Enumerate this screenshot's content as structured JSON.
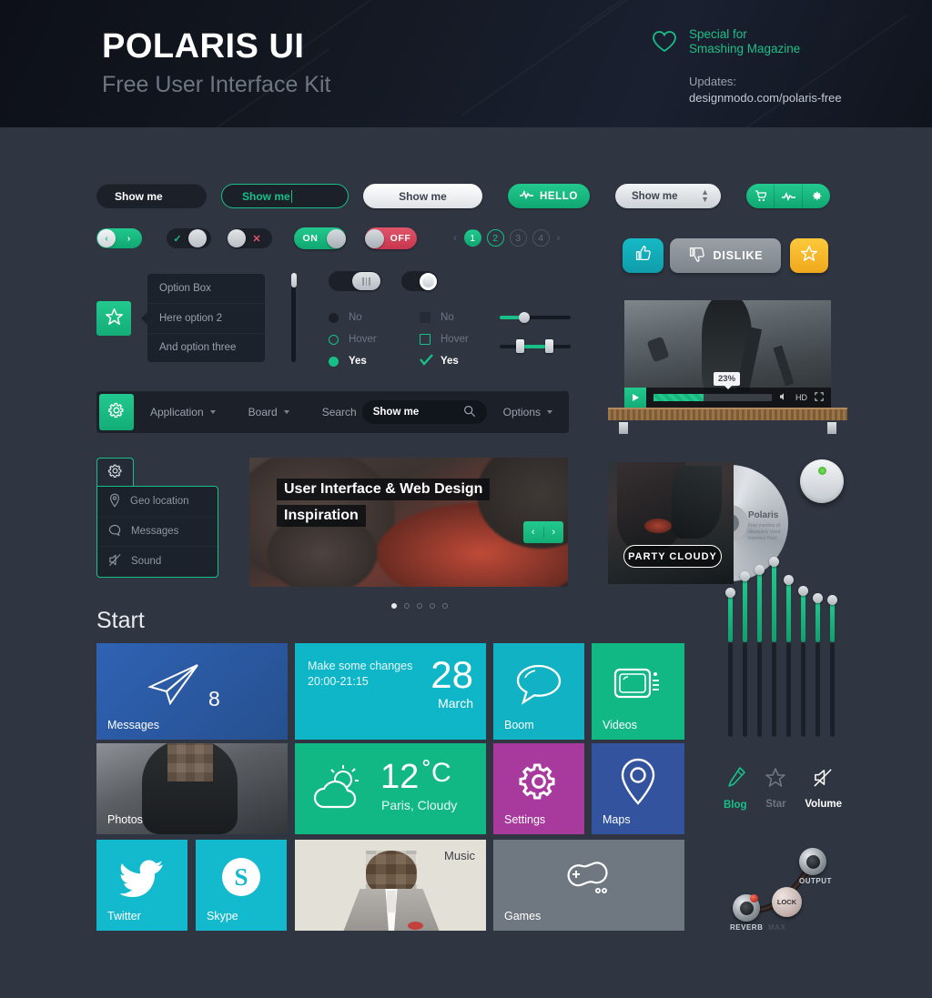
{
  "header": {
    "title": "POLARIS UI",
    "subtitle": "Free User Interface Kit",
    "special_line1": "Special for",
    "special_line2": "Smashing Magazine",
    "updates_label": "Updates:",
    "updates_url": "designmodo.com/polaris-free",
    "heart_icon": "heart-icon",
    "accent": "#18c088"
  },
  "buttons": {
    "dark": "Show me",
    "outline": "Show me",
    "white": "Show me",
    "green": "HELLO",
    "green_icon": "pulse-icon",
    "select_value": "Show me",
    "group_icons": [
      "cart-icon",
      "pulse-icon",
      "gear-icon"
    ]
  },
  "toggles": {
    "seg_prev": "‹",
    "seg_next": "›",
    "check_mark": "✓",
    "cross_mark": "✕",
    "on_label": "ON",
    "off_label": "OFF"
  },
  "pagination": {
    "prev": "‹",
    "next": "›",
    "pages": [
      "1",
      "2",
      "3",
      "4"
    ],
    "active": "1",
    "hover": "2"
  },
  "social": {
    "like_icon": "thumb-up-icon",
    "dislike_icon": "thumb-down-icon",
    "dislike_label": "DISLIKE",
    "star_icon": "star-icon",
    "like_color": "#14b3c0",
    "dislike_color": "#8d9399",
    "star_color": "#f7bd2b"
  },
  "option_box": {
    "tile_icon": "star-icon",
    "options": [
      "Option Box",
      "Here option 2",
      "And option three"
    ]
  },
  "radios": {
    "items": [
      {
        "label": "No",
        "state": "off"
      },
      {
        "label": "Hover",
        "state": "hover"
      },
      {
        "label": "Yes",
        "state": "on"
      }
    ]
  },
  "checks": {
    "items": [
      {
        "label": "No",
        "state": "off"
      },
      {
        "label": "Hover",
        "state": "hover"
      },
      {
        "label": "Yes",
        "state": "on"
      }
    ],
    "check_glyph": "✓"
  },
  "navbar": {
    "gear_icon": "gear-icon",
    "items": [
      {
        "label": "Application",
        "has_caret": true
      },
      {
        "label": "Board",
        "has_caret": true
      },
      {
        "label": "Search",
        "has_caret": false
      }
    ],
    "search_value": "Show me",
    "search_icon": "search-icon",
    "options_label": "Options"
  },
  "side_menu": {
    "tab_icon": "gear-icon",
    "items": [
      {
        "label": "Geo location",
        "icon": "pin-icon"
      },
      {
        "label": "Messages",
        "icon": "chat-icon"
      },
      {
        "label": "Sound",
        "icon": "mute-icon"
      }
    ]
  },
  "carousel": {
    "caption_line1": "User Interface & Web Design",
    "caption_line2": "Inspiration",
    "prev": "‹",
    "next": "›",
    "dots": 5,
    "active_dot": 1
  },
  "video": {
    "progress_label": "23%",
    "progress_percent": 23,
    "play_icon": "play-icon",
    "volume_icon": "volume-icon",
    "hd_label": "HD",
    "fullscreen_icon": "fullscreen-icon"
  },
  "album": {
    "badge": "PARTY CLOUDY",
    "cd_title": "Polaris",
    "cd_subtitle": "Free mention of absolutely Used Interface Pack"
  },
  "start": {
    "heading": "Start",
    "tiles": [
      {
        "name": "messages",
        "label": "Messages",
        "badge": "8",
        "icon": "paper-plane-icon",
        "color": "#2c5aa8"
      },
      {
        "name": "calendar",
        "label": "",
        "line1": "Make some changes",
        "line2": "20:00-21:15",
        "day": "28",
        "month": "March",
        "color": "#0fb6c7"
      },
      {
        "name": "boom",
        "label": "Boom",
        "icon": "chat-bubble-icon",
        "color": "#11b2c4"
      },
      {
        "name": "videos",
        "label": "Videos",
        "icon": "tv-icon",
        "color": "#11b884"
      },
      {
        "name": "photos",
        "label": "Photos",
        "color": "#4a4f55"
      },
      {
        "name": "weather",
        "label": "",
        "temp": "12",
        "unit": "˚C",
        "place": "Paris, Cloudy",
        "icon": "sun-cloud-icon",
        "color": "#11b884"
      },
      {
        "name": "settings",
        "label": "Settings",
        "icon": "gear-icon",
        "color": "#a8399d"
      },
      {
        "name": "maps",
        "label": "Maps",
        "icon": "pin-icon",
        "color": "#33539e"
      },
      {
        "name": "twitter",
        "label": "Twitter",
        "icon": "twitter-icon",
        "color": "#13b9cd"
      },
      {
        "name": "skype",
        "label": "Skype",
        "icon": "skype-icon",
        "color": "#13b9cd"
      },
      {
        "name": "music",
        "label": "Music",
        "color": "#e3e0d8"
      },
      {
        "name": "games",
        "label": "Games",
        "icon": "gamepad-icon",
        "color": "#6f7880"
      }
    ]
  },
  "equalizer": {
    "bars": [
      38,
      62,
      72,
      82,
      58,
      46,
      36,
      34
    ],
    "count": 8
  },
  "icon_row": [
    {
      "label": "Blog",
      "icon": "pencil-icon",
      "color": "#18c088"
    },
    {
      "label": "Star",
      "icon": "star-icon",
      "color": "#6e7682"
    },
    {
      "label": "Volume",
      "icon": "mute-icon",
      "color": "#ffffff"
    }
  ],
  "reverb_panel": {
    "output_label": "OUTPUT",
    "reverb_label": "REVERB",
    "max_label": "MAX",
    "lock_label": "LOCK"
  }
}
